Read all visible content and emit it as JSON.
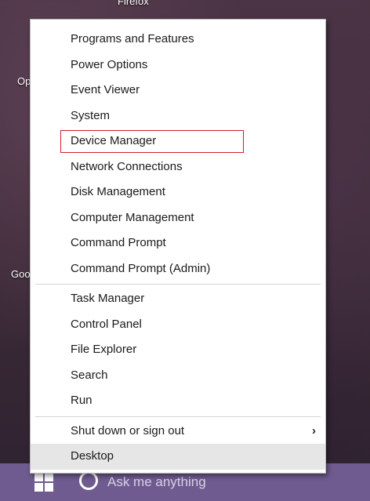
{
  "desktop": {
    "icon_labels": [
      "Firefox",
      "Op",
      "Goo"
    ]
  },
  "taskbar": {
    "search_placeholder": "Ask me anything"
  },
  "menu": {
    "groups": [
      [
        {
          "label": "Programs and Features"
        },
        {
          "label": "Power Options"
        },
        {
          "label": "Event Viewer"
        },
        {
          "label": "System"
        },
        {
          "label": "Device Manager"
        },
        {
          "label": "Network Connections"
        },
        {
          "label": "Disk Management"
        },
        {
          "label": "Computer Management"
        },
        {
          "label": "Command Prompt"
        },
        {
          "label": "Command Prompt (Admin)"
        }
      ],
      [
        {
          "label": "Task Manager"
        },
        {
          "label": "Control Panel"
        },
        {
          "label": "File Explorer"
        },
        {
          "label": "Search"
        },
        {
          "label": "Run"
        }
      ],
      [
        {
          "label": "Shut down or sign out",
          "submenu_glyph": "›"
        },
        {
          "label": "Desktop"
        }
      ]
    ]
  },
  "colors": {
    "highlight_outline": "#d0202a",
    "hover_background": "#e6e6e6",
    "taskbar": "#6f5b90"
  }
}
